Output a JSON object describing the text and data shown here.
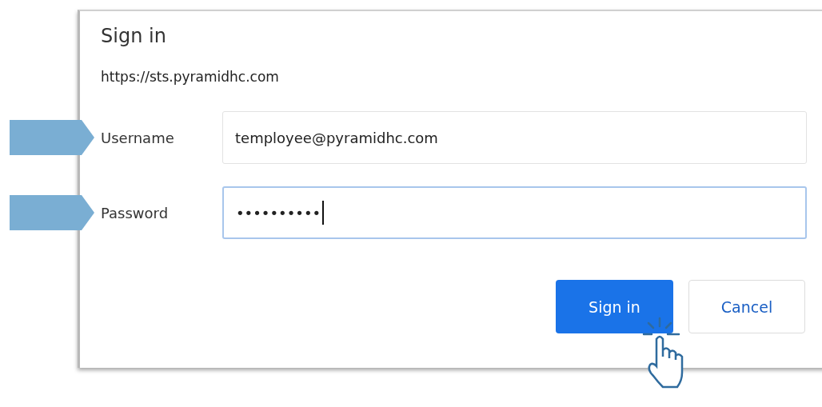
{
  "dialog": {
    "title": "Sign in",
    "url": "https://sts.pyramidhc.com"
  },
  "fields": [
    {
      "label": "Username",
      "value": "temployee@pyramidhc.com",
      "focused": false,
      "arrow": true
    },
    {
      "label": "Password",
      "value": "••••••••••",
      "focused": true,
      "arrow": true
    }
  ],
  "buttons": [
    {
      "label": "Sign in",
      "kind": "primary",
      "pointer": true
    },
    {
      "label": "Cancel",
      "kind": "secondary",
      "pointer": false
    }
  ]
}
